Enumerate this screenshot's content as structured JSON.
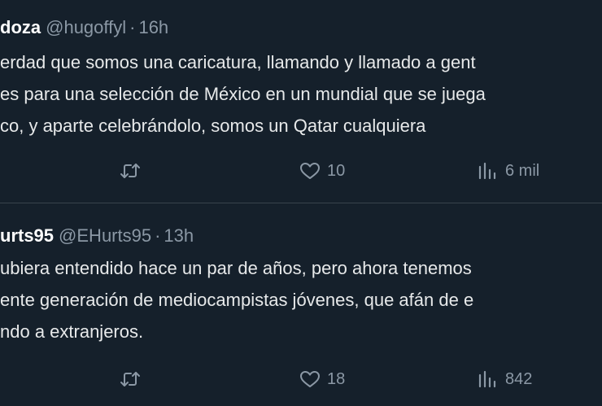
{
  "tweets": [
    {
      "name": "doza",
      "handle": "@hugoffyl",
      "separator": "·",
      "time": "16h",
      "lines": [
        "erdad que somos una caricatura, llamando y llamado a gent",
        "es para una selección de México en un mundial que se juega",
        "co, y aparte celebrándolo, somos un Qatar cualquiera"
      ],
      "likes": "10",
      "views": "6 mil"
    },
    {
      "name": "urts95",
      "handle": "@EHurts95",
      "separator": "·",
      "time": "13h",
      "lines": [
        "ubiera entendido hace un par de años, pero ahora tenemos",
        "ente generación de mediocampistas jóvenes, que afán de e",
        "ndo a extranjeros."
      ],
      "likes": "18",
      "views": "842"
    }
  ],
  "icons": {
    "retweet": "retweet-icon",
    "like": "heart-icon",
    "views": "views-icon"
  },
  "colors": {
    "background": "#15202b",
    "secondary_text": "#8b98a5",
    "divider": "#38444d"
  }
}
